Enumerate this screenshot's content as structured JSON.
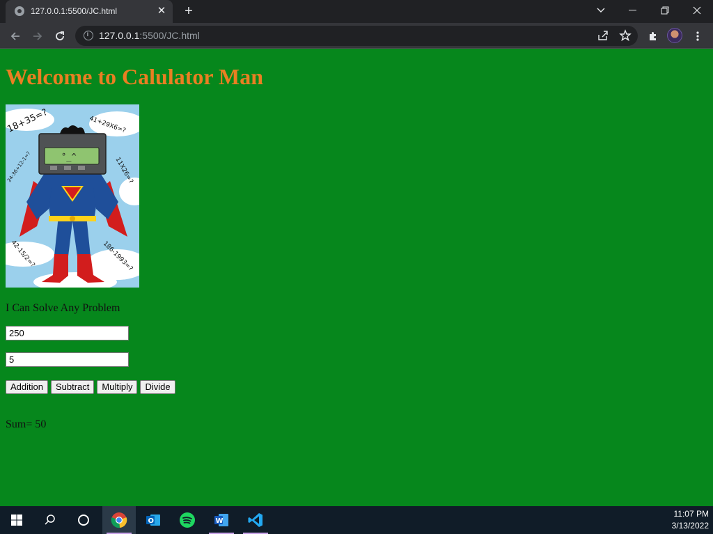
{
  "browser": {
    "tab_title": "127.0.0.1:5500/JC.html",
    "url_host": "127.0.0.1",
    "url_path": ":5500/JC.html"
  },
  "page": {
    "heading": "Welcome to Calulator Man",
    "tagline": "I Can Solve Any Problem",
    "input1_value": "250",
    "input2_value": "5",
    "buttons": {
      "add": "Addition",
      "subtract": "Subtract",
      "multiply": "Multiply",
      "divide": "Divide"
    },
    "result": "Sum= 50",
    "colors": {
      "background": "#06871c",
      "heading": "#ea7f22"
    },
    "image_doodles": [
      "18+35=?",
      "41+29X6=?",
      "11X26=?",
      "24-36+12-1=?",
      "42-15/2=?",
      "186-1993=?"
    ]
  },
  "taskbar": {
    "time": "11:07 PM",
    "date": "3/13/2022"
  }
}
